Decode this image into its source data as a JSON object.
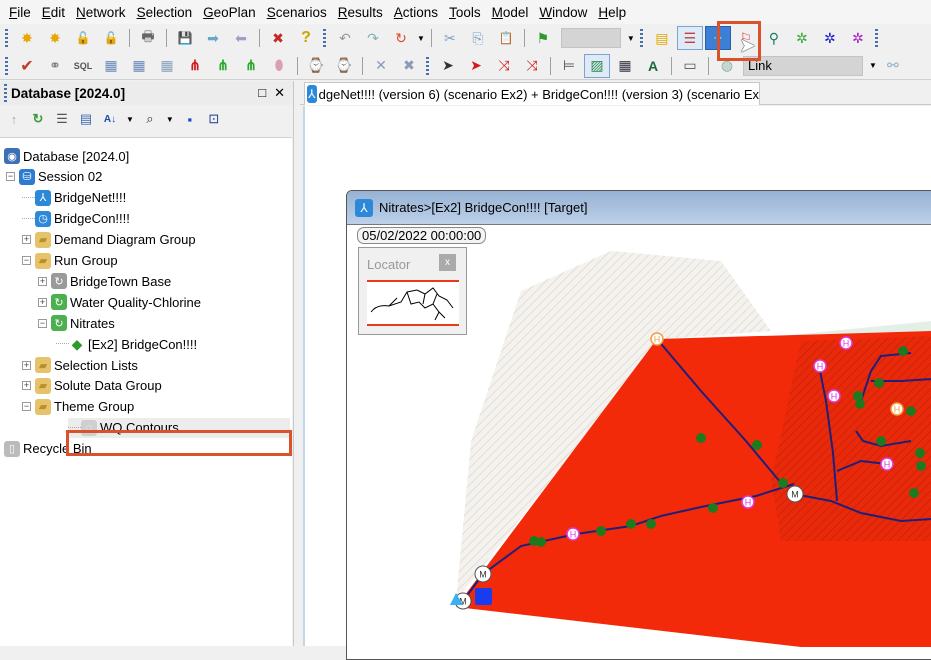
{
  "menu": [
    {
      "label": "File",
      "accel": "F",
      "rest": "ile"
    },
    {
      "label": "Edit",
      "accel": "E",
      "rest": "dit"
    },
    {
      "label": "Network",
      "accel": "N",
      "rest": "etwork"
    },
    {
      "label": "Selection",
      "accel": "S",
      "rest": "election"
    },
    {
      "label": "GeoPlan",
      "accel": "G",
      "rest": "eoPlan"
    },
    {
      "label": "Scenarios",
      "accel": "S",
      "rest": "cenarios"
    },
    {
      "label": "Results",
      "accel": "R",
      "rest": "esults"
    },
    {
      "label": "Actions",
      "accel": "A",
      "rest": "ctions"
    },
    {
      "label": "Tools",
      "accel": "T",
      "rest": "ools"
    },
    {
      "label": "Model",
      "accel": "M",
      "rest": "odel"
    },
    {
      "label": "Window",
      "accel": "W",
      "rest": "indow"
    },
    {
      "label": "Help",
      "accel": "H",
      "rest": "elp"
    }
  ],
  "toolbar": {
    "combo1_value": "",
    "combo2_value": "Link"
  },
  "icons": {
    "new": "✸",
    "newsub": "✸",
    "unlock": "🔓",
    "unlock2": "🔓",
    "print": "🖶",
    "save": "💾",
    "forward": "➡",
    "back": "⬅",
    "bug": "✖",
    "help": "?",
    "undo": "↶",
    "redo": "↷",
    "redo2": "↻",
    "cut": "✂",
    "copy": "⎘",
    "paste": "📋",
    "flag": "⚑",
    "theme": "▤",
    "list": "☰",
    "nodes": "⁘",
    "flagcolor": "⚐",
    "pin": "⚲",
    "gear1": "✲",
    "gear2": "✲",
    "gear3": "✲",
    "check": "✔",
    "connect": "⚭",
    "sql": "SQL",
    "grid": "▦",
    "grid2": "▦",
    "grid3": "▦",
    "tree_red": "⋔",
    "tree_green": "⋔",
    "tree_green2": "⋔",
    "blob": "⬮",
    "binoc_clock": "⌚",
    "xy_clock": "⌚",
    "x": "✕",
    "grid_x": "✖",
    "pointer": "➶"
  },
  "db_panel": {
    "title": "Database [2024.0]",
    "restore_icon": "□",
    "close_icon": "✕",
    "tools": [
      "↑",
      "↻",
      "☰",
      "▤",
      "A↓",
      "⌕",
      "▪",
      "⊡"
    ]
  },
  "tree": [
    {
      "label": "Database [2024.0]",
      "indent": 0,
      "expander": "",
      "icon": "db",
      "color": "#3b6fb6"
    },
    {
      "label": "Session 02",
      "indent": 1,
      "expander": "−",
      "icon": "session",
      "color": "#2c7bd0"
    },
    {
      "label": "BridgeNet!!!!",
      "indent": 2,
      "expander": "",
      "icon": "network",
      "color": "#2c88d9"
    },
    {
      "label": "BridgeCon!!!!",
      "indent": 2,
      "expander": "",
      "icon": "control",
      "color": "#2c88d9"
    },
    {
      "label": "Demand Diagram Group",
      "indent": 2,
      "expander": "+",
      "icon": "folder",
      "color": "#e6c36a"
    },
    {
      "label": "Run Group",
      "indent": 2,
      "expander": "−",
      "icon": "folder",
      "color": "#e6c36a"
    },
    {
      "label": "BridgeTown Base",
      "indent": 3,
      "expander": "+",
      "icon": "run",
      "color": "#9a9a9a"
    },
    {
      "label": "Water Quality-Chlorine",
      "indent": 3,
      "expander": "+",
      "icon": "run",
      "color": "#4caf50"
    },
    {
      "label": "Nitrates",
      "indent": 3,
      "expander": "−",
      "icon": "run",
      "color": "#4caf50"
    },
    {
      "label": "[Ex2] BridgeCon!!!!",
      "indent": 4,
      "expander": "",
      "icon": "sim",
      "color": "#2e9a2e"
    },
    {
      "label": "Selection Lists",
      "indent": 2,
      "expander": "+",
      "icon": "folder",
      "color": "#e6c36a"
    },
    {
      "label": "Solute Data Group",
      "indent": 2,
      "expander": "+",
      "icon": "folder",
      "color": "#e6c36a"
    },
    {
      "label": "Theme Group",
      "indent": 2,
      "expander": "−",
      "icon": "folder",
      "color": "#e6c36a"
    },
    {
      "label": "WQ Contours",
      "indent": 3,
      "expander": "",
      "icon": "theme",
      "color": "#cfcfcf",
      "selected": true
    },
    {
      "label": "Recycle Bin",
      "indent": 0,
      "expander": "",
      "icon": "bin",
      "color": "#bbbbbb"
    }
  ],
  "main_tab": {
    "label": "dgeNet!!!! (version 6) (scenario Ex2)  + BridgeCon!!!! (version 3) (scenario Ex"
  },
  "child_window": {
    "title": "Nitrates>[Ex2] BridgeCon!!!!  [Target]",
    "timestamp": "05/02/2022 00:00:00",
    "locator_label": "Locator",
    "locator_close": "x"
  },
  "map": {
    "contour_color": "#f22a0a",
    "dark_contour_color": "#d81f08",
    "pipe_color": "#1f1f7a",
    "node_color": "#1e7a1e",
    "hydrant_label": "H",
    "meter_label": "M"
  },
  "colors": {
    "highlight": "#d9522c",
    "active_button": "#3d7fd6"
  }
}
